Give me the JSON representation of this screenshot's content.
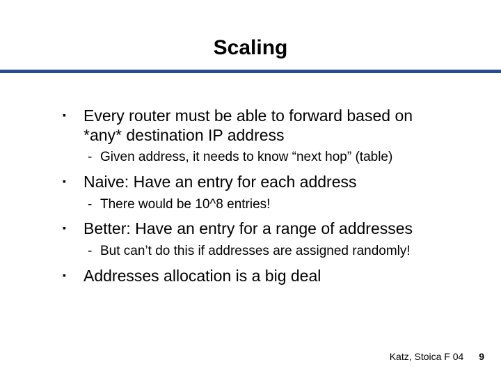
{
  "title": "Scaling",
  "bullets": [
    {
      "text": "Every router must be able to forward based on *any* destination IP address",
      "sub": [
        "Given address, it needs to know “next hop” (table)"
      ]
    },
    {
      "text": "Naive: Have an entry for each address",
      "sub": [
        "There would be 10^8 entries!"
      ]
    },
    {
      "text": "Better: Have an entry for a range of addresses",
      "sub": [
        "But can’t do this if addresses are assigned randomly!"
      ]
    },
    {
      "text": "Addresses allocation is a big deal",
      "sub": []
    }
  ],
  "footer": {
    "attribution": "Katz, Stoica F 04",
    "page_number": "9"
  }
}
